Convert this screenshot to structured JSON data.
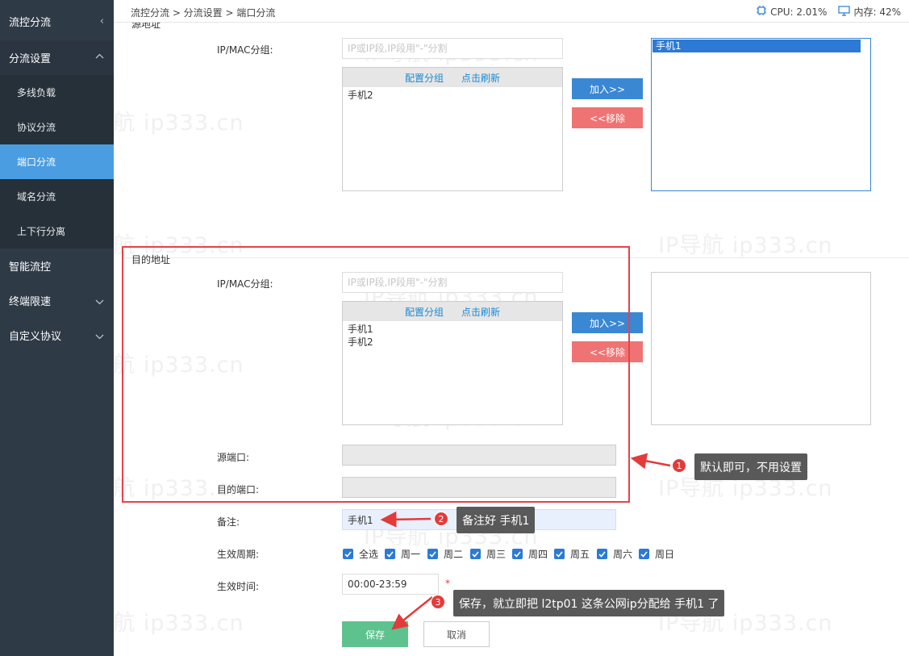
{
  "sidebar": {
    "title": "流控分流",
    "section": "分流设置",
    "sub_items": [
      {
        "label": "多线负载"
      },
      {
        "label": "协议分流"
      },
      {
        "label": "端口分流"
      },
      {
        "label": "域名分流"
      },
      {
        "label": "上下行分离"
      }
    ],
    "items": [
      {
        "label": "智能流控"
      },
      {
        "label": "终端限速"
      },
      {
        "label": "自定义协议"
      }
    ]
  },
  "header": {
    "breadcrumb": "流控分流 > 分流设置 > 端口分流",
    "cpu": "CPU: 2.01%",
    "mem": "内存: 42%"
  },
  "watermark": "IP导航  ip333.cn",
  "source": {
    "section_title": "源地址",
    "ipmac_label": "IP/MAC分组:",
    "ipmac_placeholder": "IP或IP段,IP段用\"-\"分割",
    "link_config": "配置分组",
    "link_refresh": "点击刷新",
    "available": [
      "手机2"
    ],
    "selected": [
      "手机1"
    ],
    "add_btn": "加入>>",
    "remove_btn": "<<移除"
  },
  "dest": {
    "section_title": "目的地址",
    "ipmac_label": "IP/MAC分组:",
    "ipmac_placeholder": "IP或IP段,IP段用\"-\"分割",
    "link_config": "配置分组",
    "link_refresh": "点击刷新",
    "available": [
      "手机1",
      "手机2"
    ],
    "add_btn": "加入>>",
    "remove_btn": "<<移除"
  },
  "form": {
    "src_port_label": "源端口:",
    "dst_port_label": "目的端口:",
    "remark_label": "备注:",
    "remark_value": "手机1",
    "period_label": "生效周期:",
    "days": [
      "全选",
      "周一",
      "周二",
      "周三",
      "周四",
      "周五",
      "周六",
      "周日"
    ],
    "time_label": "生效时间:",
    "time_value": "00:00-23:59",
    "required_mark": "*",
    "save": "保存",
    "cancel": "取消"
  },
  "annotations": {
    "n1": "1",
    "tip1": "默认即可，不用设置",
    "n2": "2",
    "tip2": "备注好 手机1",
    "n3": "3",
    "tip3": "保存，就立即把 l2tp01 这条公网ip分配给 手机1 了"
  },
  "colors": {
    "sidebar_bg": "#2f3a47",
    "sidebar_active": "#4a9de0",
    "accent_blue": "#3a87d4",
    "remove_red": "#f07373",
    "save_green": "#5ec28f",
    "annotation_red": "#e8414a"
  }
}
